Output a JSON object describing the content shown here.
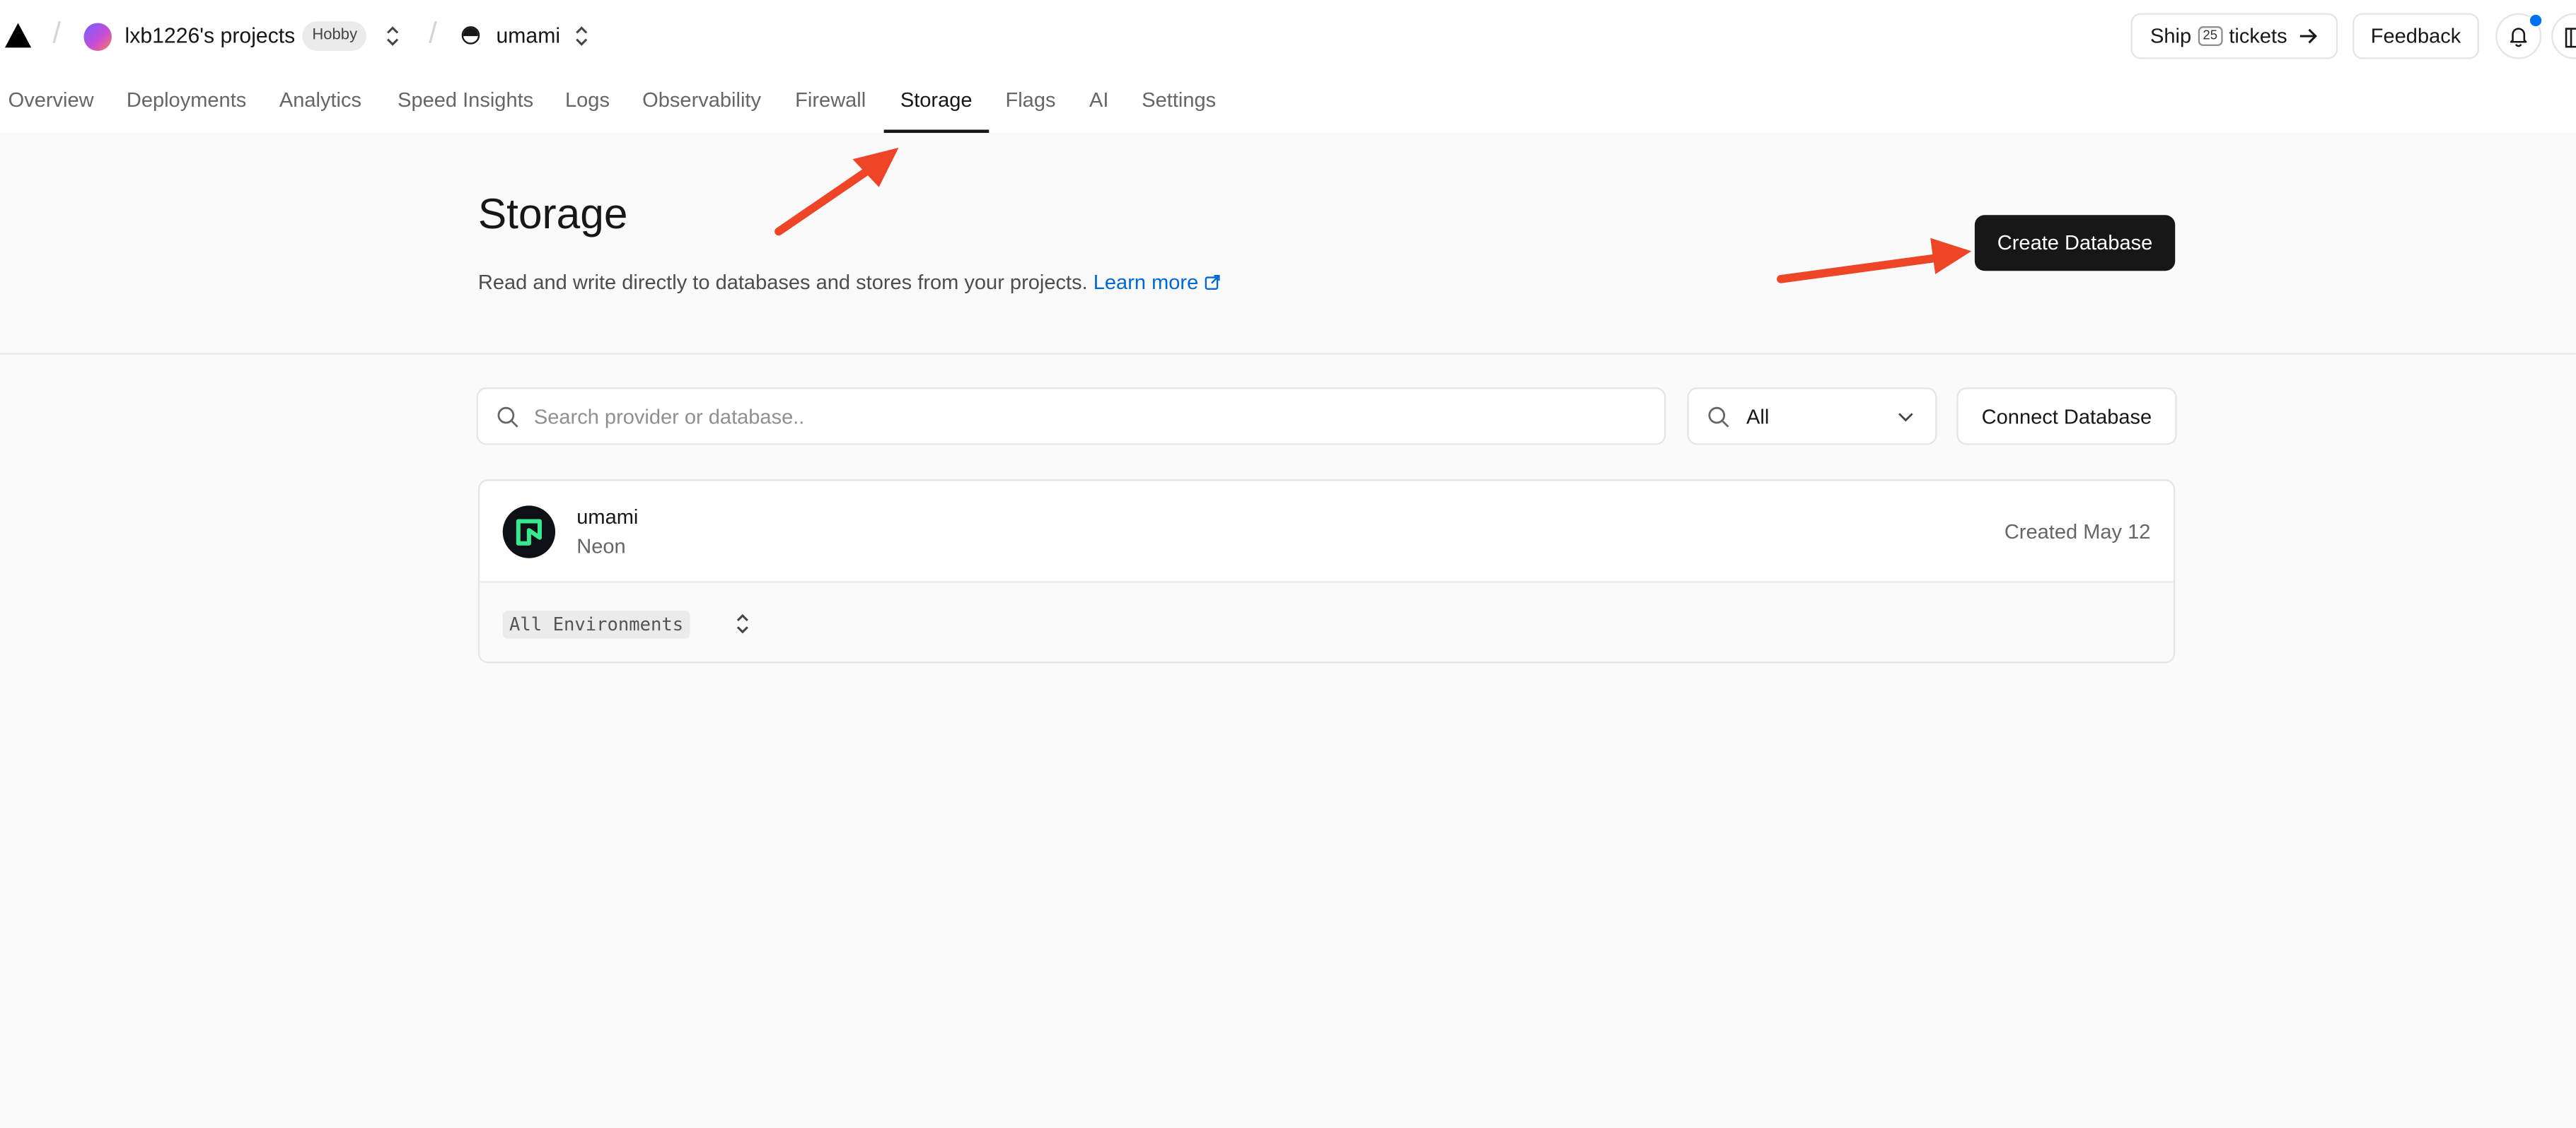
{
  "topbar": {
    "team_name": "lxb1226's projects",
    "plan_badge": "Hobby",
    "project_name": "umami",
    "ship_label_pre": "Ship",
    "ship_label_kbd": "25",
    "ship_label_post": "tickets",
    "feedback_label": "Feedback"
  },
  "tabs": [
    {
      "label": "Overview"
    },
    {
      "label": "Deployments"
    },
    {
      "label": "Analytics"
    },
    {
      "label": "Speed Insights"
    },
    {
      "label": "Logs"
    },
    {
      "label": "Observability"
    },
    {
      "label": "Firewall"
    },
    {
      "label": "Storage"
    },
    {
      "label": "Flags"
    },
    {
      "label": "AI"
    },
    {
      "label": "Settings"
    }
  ],
  "active_tab": "Storage",
  "header": {
    "title": "Storage",
    "description": "Read and write directly to databases and stores from your projects.",
    "learn_more": "Learn more",
    "create_button": "Create Database"
  },
  "search": {
    "placeholder": "Search provider or database..",
    "value": ""
  },
  "filter": {
    "selected": "All"
  },
  "connect_button": "Connect Database",
  "databases": [
    {
      "name": "umami",
      "provider": "Neon",
      "created": "Created May 12",
      "environment": "All Environments"
    }
  ],
  "colors": {
    "primary_button": "#171717",
    "link": "#0068d6",
    "notification_dot": "#0070f3",
    "annotation_arrow": "#ee4527",
    "neon_green": "#37e88f"
  }
}
